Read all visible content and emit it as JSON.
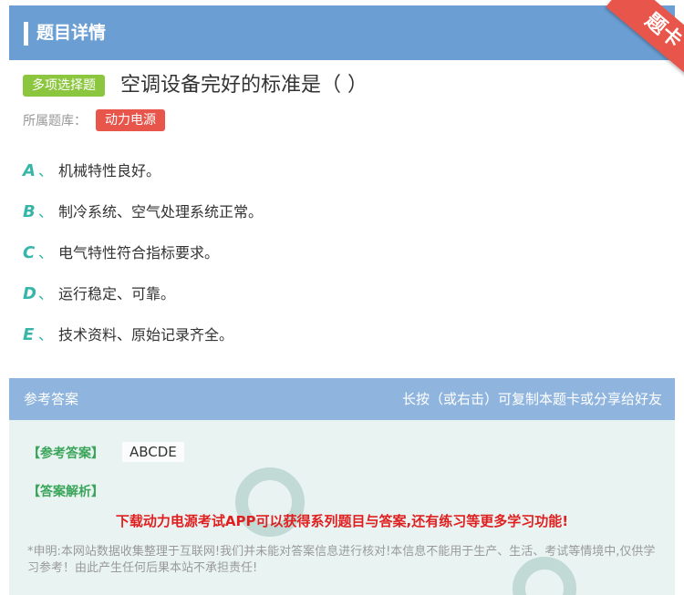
{
  "header": {
    "title": "题目详情"
  },
  "ribbon": {
    "label": "题卡",
    "color": "#e8554b"
  },
  "question": {
    "type_label": "多项选择题",
    "text": "空调设备完好的标准是（ ）",
    "bank_label": "所属题库：",
    "bank_name": "动力电源"
  },
  "options": [
    {
      "letter": "A",
      "sep": "、",
      "text": "机械特性良好。"
    },
    {
      "letter": "B",
      "sep": "、",
      "text": "制冷系统、空气处理系统正常。"
    },
    {
      "letter": "C",
      "sep": "、",
      "text": "电气特性符合指标要求。"
    },
    {
      "letter": "D",
      "sep": "、",
      "text": "运行稳定、可靠。"
    },
    {
      "letter": "E",
      "sep": "、",
      "text": "技术资料、原始记录齐全。"
    }
  ],
  "answer_section": {
    "title": "参考答案",
    "hint": "长按（或右击）可复制本题卡或分享给好友",
    "answer_label": "【参考答案】",
    "answer_value": "ABCDE",
    "explain_label": "【答案解析】",
    "promo": "下载动力电源考试APP可以获得系列题目与答案,还有练习等更多学习功能!",
    "disclaimer": "*申明:本网站数据收集整理于互联网!我们并未能对答案信息进行核对!本信息不能用于生产、生活、考试等情境中,仅供学习参考！由此产生任何后果本站不承担责任!"
  },
  "colors": {
    "header_bg": "#6b9fd4",
    "answer_bar_bg": "#8fb5de",
    "accent_green": "#8cc63f",
    "accent_teal": "#36b5a8",
    "accent_red": "#e8554b"
  }
}
